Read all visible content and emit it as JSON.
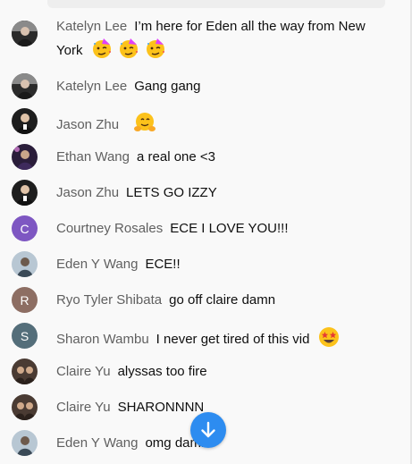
{
  "colors": {
    "background": "#f9f9f9",
    "author": "#606060",
    "text": "#0f0f0f",
    "scroll_button": "#2d8cf0",
    "avatar_courtney": "#7e57c2",
    "avatar_ryo": "#8d6e63",
    "avatar_sharon": "#546e7a"
  },
  "messages": [
    {
      "author": "Katelyn Lee",
      "text": "I’m here for Eden all the way from New York",
      "avatar": "photo",
      "emojis": [
        "partying-face-emoji",
        "partying-face-emoji",
        "partying-face-emoji"
      ]
    },
    {
      "author": "Katelyn Lee",
      "text": "Gang gang",
      "avatar": "photo"
    },
    {
      "author": "Jason Zhu",
      "text": "",
      "avatar": "photo",
      "emojis": [
        "hugging-face-emoji"
      ]
    },
    {
      "author": "Ethan Wang",
      "text": "a real one <3",
      "avatar": "photo"
    },
    {
      "author": "Jason Zhu",
      "text": "LETS GO IZZY",
      "avatar": "photo"
    },
    {
      "author": "Courtney Rosales",
      "text": "ECE I LOVE YOU!!!",
      "avatar_letter": "C"
    },
    {
      "author": "Eden Y Wang",
      "text": "ECE!!",
      "avatar": "photo"
    },
    {
      "author": "Ryo Tyler Shibata",
      "text": "go off claire damn",
      "avatar_letter": "R"
    },
    {
      "author": "Sharon Wambu",
      "text": "I never get tired of this vid",
      "avatar_letter": "S",
      "emojis": [
        "star-struck-emoji"
      ]
    },
    {
      "author": "Claire Yu",
      "text": "alyssas too fire",
      "avatar": "photo"
    },
    {
      "author": "Claire Yu",
      "text": "SHARONNNN",
      "avatar": "photo"
    },
    {
      "author": "Eden Y Wang",
      "text": "omg damn",
      "avatar": "photo"
    }
  ]
}
